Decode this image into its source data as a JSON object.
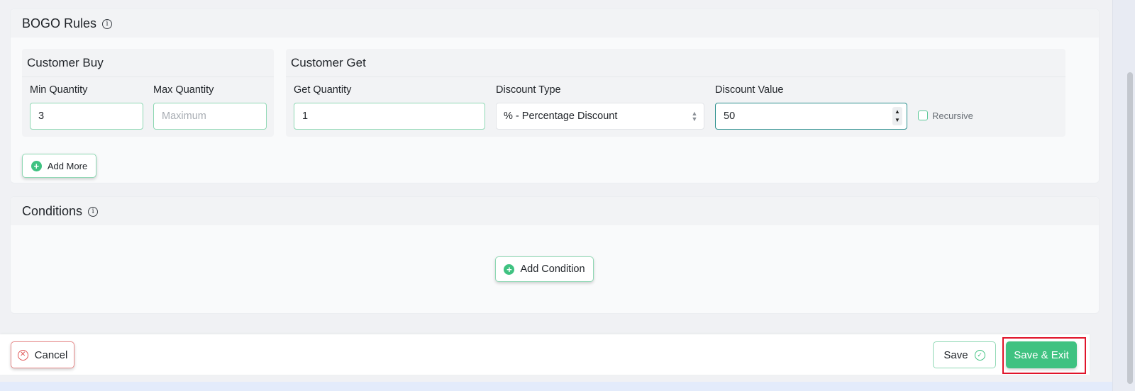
{
  "bogo_rules": {
    "title": "BOGO Rules",
    "info_icon": "info-icon",
    "customer_buy": {
      "title": "Customer Buy",
      "min_quantity": {
        "label": "Min Quantity",
        "value": "3"
      },
      "max_quantity": {
        "label": "Max Quantity",
        "placeholder": "Maximum"
      }
    },
    "customer_get": {
      "title": "Customer Get",
      "get_quantity": {
        "label": "Get Quantity",
        "value": "1"
      },
      "discount_type": {
        "label": "Discount Type",
        "selected": "% - Percentage Discount"
      },
      "discount_value": {
        "label": "Discount Value",
        "value": "50"
      },
      "recursive": {
        "label": "Recursive",
        "checked": false
      }
    },
    "add_more_label": "Add More"
  },
  "conditions": {
    "title": "Conditions",
    "info_icon": "info-icon",
    "add_condition_label": "Add Condition"
  },
  "footer": {
    "cancel_label": "Cancel",
    "save_label": "Save",
    "save_exit_label": "Save & Exit"
  },
  "colors": {
    "accent_green": "#3fc281",
    "input_border": "#8fd8b4",
    "focus_border": "#2a8f8d",
    "cancel_red": "#e05656",
    "highlight_red": "#e0142a"
  }
}
